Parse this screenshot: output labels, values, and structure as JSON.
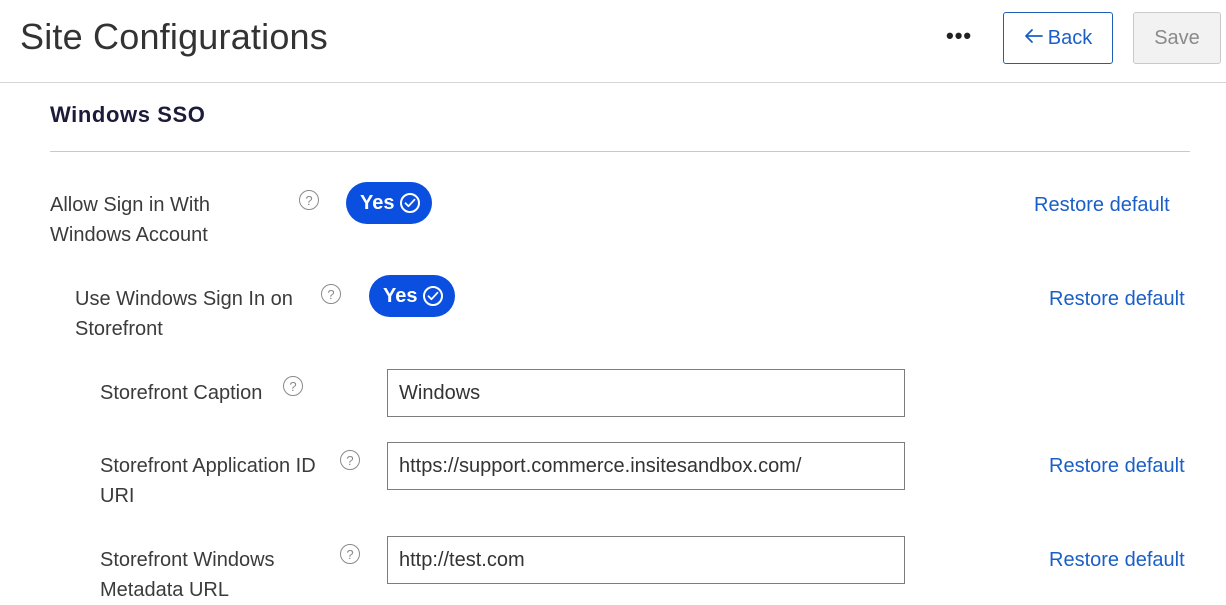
{
  "header": {
    "title": "Site Configurations",
    "more_label": "•••",
    "back_label": "Back",
    "save_label": "Save"
  },
  "section": {
    "title": "Windows SSO"
  },
  "rows": [
    {
      "label_line1": "Allow Sign in With",
      "label_line2": "Windows Account",
      "help": "?",
      "toggle": "Yes",
      "restore": "Restore default"
    },
    {
      "label_line1": "Use Windows Sign In on",
      "label_line2": "Storefront",
      "help": "?",
      "toggle": "Yes",
      "restore": "Restore default"
    },
    {
      "label_line1": "Storefront Caption",
      "help": "?",
      "value": "Windows"
    },
    {
      "label_line1": "Storefront Application ID",
      "label_line2": "URI",
      "help": "?",
      "value": "https://support.commerce.insitesandbox.com/",
      "restore": "Restore default"
    },
    {
      "label_line1": "Storefront Windows",
      "label_line2": "Metadata URL",
      "help": "?",
      "value": "http://test.com",
      "restore": "Restore default"
    }
  ],
  "colors": {
    "accent": "#0a4fe0",
    "link": "#1a5fc8",
    "border": "#1f5fb8"
  },
  "icons": {
    "back": "arrow-left-icon",
    "check": "check-circle-icon",
    "help": "question-circle-icon",
    "more": "more-horizontal-icon"
  }
}
